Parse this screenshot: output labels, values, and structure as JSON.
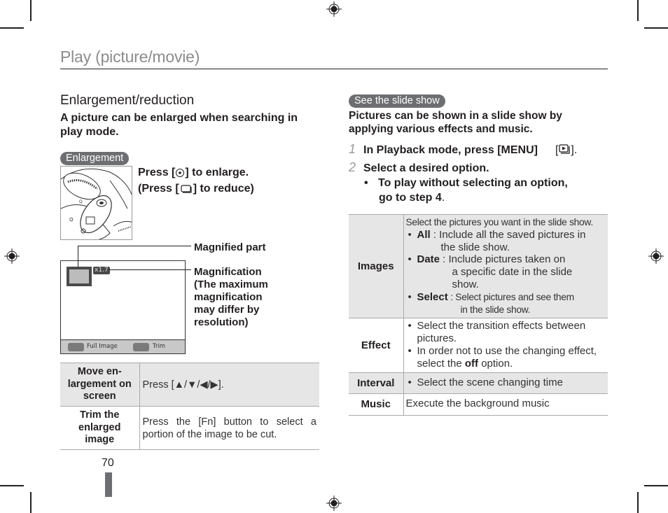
{
  "header": {
    "title": "Play (picture/movie)"
  },
  "left": {
    "heading": "Enlargement/reduction",
    "intro": "A picture can be enlarged when searching in play mode.",
    "enlargement_badge": "Enlargement",
    "press_enlarge": {
      "prefix": "Press [",
      "icon": "ok-button-icon",
      "suffix": "] to enlarge."
    },
    "press_reduce": {
      "prefix": "(Press [",
      "icon": "thumbnail-button-icon",
      "suffix": "] to reduce)"
    },
    "screen": {
      "magnification": "x1.7",
      "left_button_label": "Full Image",
      "right_button_label": "Trim"
    },
    "callouts": {
      "magnified_part": "Magnified part",
      "magnification": [
        "Magnification",
        "(The maximum",
        "magnification",
        "may differ by",
        "resolution)"
      ]
    },
    "table": [
      {
        "key_lines": [
          "Move en-",
          "largement on",
          "screen"
        ],
        "value": "Press [▲/▼/◀/▶]."
      },
      {
        "key_lines": [
          "Trim the",
          "enlarged",
          "image"
        ],
        "value": "Press the [Fn] button to select a portion of the image to be cut."
      }
    ]
  },
  "right": {
    "badge": "See the slide show",
    "intro": "Pictures can be shown in a slide show by applying various effects and music.",
    "steps": [
      {
        "num": "1",
        "text_before": "In Playback mode, press ",
        "bold": "[MENU]",
        "text_after": "[",
        "icon": "slideshow-icon",
        "end": "]."
      },
      {
        "num": "2",
        "text": "Select a desired option."
      }
    ],
    "sub_bullet": {
      "line1": "To play without selecting an option,",
      "line2_prefix": "go to ",
      "line2_bold": "step 4",
      "line2_suffix": "."
    },
    "table": {
      "images": {
        "key": "Images",
        "lead": "Select the pictures you want in the slide show.",
        "items": [
          {
            "label": "All",
            "text1": " : Include all the saved pictures in",
            "text2": "the slide show."
          },
          {
            "label": "Date",
            "text1": " : Include pictures taken on",
            "text2": "a specific date in the slide",
            "text3": "show."
          },
          {
            "label": "Select",
            "text1": " : Select pictures and see them",
            "text2": "in the slide show."
          }
        ]
      },
      "effect": {
        "key": "Effect",
        "bullet1": "Select the transition effects between pictures.",
        "bullet2_prefix": "In order not to use the changing effect, select the ",
        "bullet2_bold": "off",
        "bullet2_suffix": " option."
      },
      "interval": {
        "key": "Interval",
        "bullet": "Select the scene changing time"
      },
      "music": {
        "key": "Music",
        "value": "Execute the background music"
      }
    }
  },
  "footer": {
    "page_number": "70"
  }
}
